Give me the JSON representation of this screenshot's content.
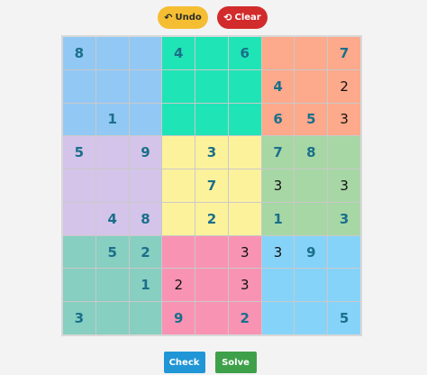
{
  "controls": {
    "undo_label": "Undo",
    "undo_icon": "↶",
    "clear_label": "Clear",
    "clear_icon": "⟲",
    "check_label": "Check",
    "solve_label": "Solve"
  },
  "colors": {
    "box_colors": [
      "#92c8f4",
      "#1fe4b6",
      "#fda98b",
      "#d4c4ea",
      "#fdf29c",
      "#a7d7a5",
      "#86cfc1",
      "#f893b4",
      "#86d3fa"
    ],
    "given_digit": "#1a6f8a",
    "user_digit": "#111111",
    "undo": "#f5be32",
    "clear": "#d22b2b",
    "check": "#2196d6",
    "solve": "#3fa04a"
  },
  "grid": [
    [
      {
        "v": "8",
        "g": true
      },
      {
        "v": "",
        "g": false
      },
      {
        "v": "",
        "g": false
      },
      {
        "v": "4",
        "g": true
      },
      {
        "v": "",
        "g": false
      },
      {
        "v": "6",
        "g": true
      },
      {
        "v": "",
        "g": false
      },
      {
        "v": "",
        "g": false
      },
      {
        "v": "7",
        "g": true
      }
    ],
    [
      {
        "v": "",
        "g": false
      },
      {
        "v": "",
        "g": false
      },
      {
        "v": "",
        "g": false
      },
      {
        "v": "",
        "g": false
      },
      {
        "v": "",
        "g": false
      },
      {
        "v": "",
        "g": false
      },
      {
        "v": "4",
        "g": true
      },
      {
        "v": "",
        "g": false
      },
      {
        "v": "2",
        "g": false
      }
    ],
    [
      {
        "v": "",
        "g": false
      },
      {
        "v": "1",
        "g": true
      },
      {
        "v": "",
        "g": false
      },
      {
        "v": "",
        "g": false
      },
      {
        "v": "",
        "g": false
      },
      {
        "v": "",
        "g": false
      },
      {
        "v": "6",
        "g": true
      },
      {
        "v": "5",
        "g": true
      },
      {
        "v": "3",
        "g": false
      }
    ],
    [
      {
        "v": "5",
        "g": true
      },
      {
        "v": "",
        "g": false
      },
      {
        "v": "9",
        "g": true
      },
      {
        "v": "",
        "g": false
      },
      {
        "v": "3",
        "g": true
      },
      {
        "v": "",
        "g": false
      },
      {
        "v": "7",
        "g": true
      },
      {
        "v": "8",
        "g": true
      },
      {
        "v": "",
        "g": false
      }
    ],
    [
      {
        "v": "",
        "g": false
      },
      {
        "v": "",
        "g": false
      },
      {
        "v": "",
        "g": false
      },
      {
        "v": "",
        "g": false
      },
      {
        "v": "7",
        "g": true
      },
      {
        "v": "",
        "g": false
      },
      {
        "v": "3",
        "g": false
      },
      {
        "v": "",
        "g": false
      },
      {
        "v": "3",
        "g": false
      }
    ],
    [
      {
        "v": "",
        "g": false
      },
      {
        "v": "4",
        "g": true
      },
      {
        "v": "8",
        "g": true
      },
      {
        "v": "",
        "g": false
      },
      {
        "v": "2",
        "g": true
      },
      {
        "v": "",
        "g": false
      },
      {
        "v": "1",
        "g": true
      },
      {
        "v": "",
        "g": false
      },
      {
        "v": "3",
        "g": true
      }
    ],
    [
      {
        "v": "",
        "g": false
      },
      {
        "v": "5",
        "g": true
      },
      {
        "v": "2",
        "g": true
      },
      {
        "v": "",
        "g": false
      },
      {
        "v": "",
        "g": false
      },
      {
        "v": "3",
        "g": false
      },
      {
        "v": "3",
        "g": false
      },
      {
        "v": "9",
        "g": true
      },
      {
        "v": "",
        "g": false
      }
    ],
    [
      {
        "v": "",
        "g": false
      },
      {
        "v": "",
        "g": false
      },
      {
        "v": "1",
        "g": true
      },
      {
        "v": "2",
        "g": false
      },
      {
        "v": "",
        "g": false
      },
      {
        "v": "3",
        "g": false
      },
      {
        "v": "",
        "g": false
      },
      {
        "v": "",
        "g": false
      },
      {
        "v": "",
        "g": false
      }
    ],
    [
      {
        "v": "3",
        "g": true
      },
      {
        "v": "",
        "g": false
      },
      {
        "v": "",
        "g": false
      },
      {
        "v": "9",
        "g": true
      },
      {
        "v": "",
        "g": false
      },
      {
        "v": "2",
        "g": true
      },
      {
        "v": "",
        "g": false
      },
      {
        "v": "",
        "g": false
      },
      {
        "v": "5",
        "g": true
      }
    ]
  ]
}
